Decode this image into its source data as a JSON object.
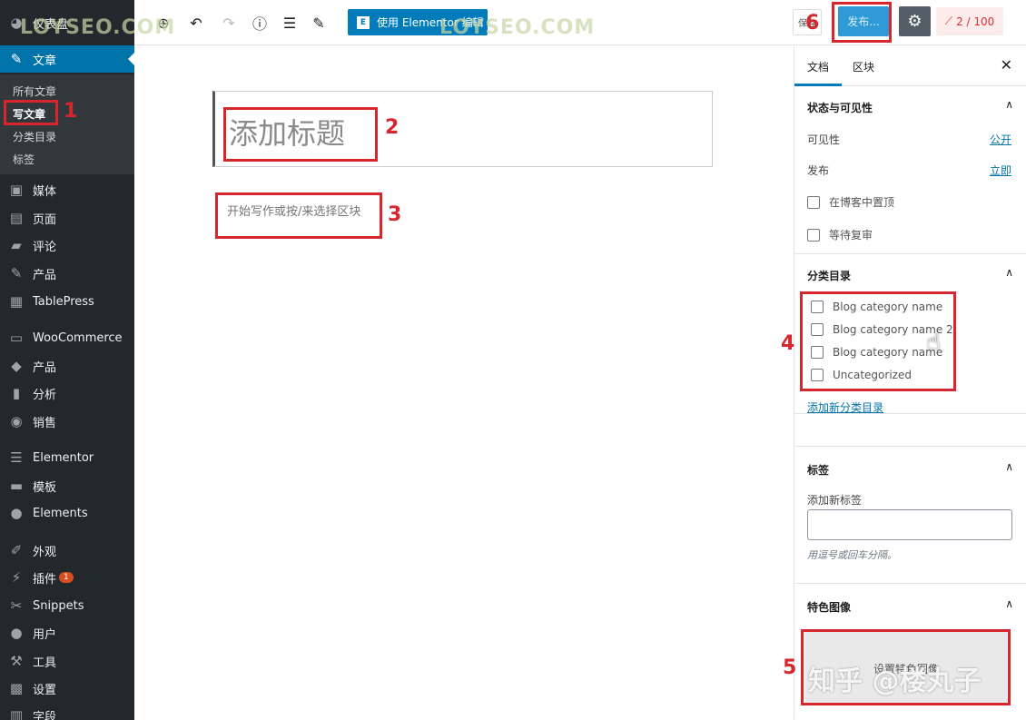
{
  "admin_menu": {
    "items": [
      {
        "label": "仪表盘",
        "icon": "dashboard-icon"
      },
      {
        "label": "文章",
        "icon": "pin-icon"
      },
      {
        "label": "媒体",
        "icon": "media-icon"
      },
      {
        "label": "页面",
        "icon": "pages-icon"
      },
      {
        "label": "评论",
        "icon": "comments-icon"
      },
      {
        "label": "产品",
        "icon": "pin-icon"
      },
      {
        "label": "TablePress",
        "icon": "table-icon"
      },
      {
        "label": "WooCommerce",
        "icon": "woocommerce-icon"
      },
      {
        "label": "产品",
        "icon": "box-icon"
      },
      {
        "label": "分析",
        "icon": "chart-icon"
      },
      {
        "label": "销售",
        "icon": "megaphone-icon"
      },
      {
        "label": "Elementor",
        "icon": "elementor-icon"
      },
      {
        "label": "模板",
        "icon": "folder-icon"
      },
      {
        "label": "Elements",
        "icon": "leaf-icon"
      },
      {
        "label": "外观",
        "icon": "brush-icon"
      },
      {
        "label": "插件",
        "icon": "plugin-icon",
        "badge": "1"
      },
      {
        "label": "Snippets",
        "icon": "scissors-icon"
      },
      {
        "label": "用户",
        "icon": "user-icon"
      },
      {
        "label": "工具",
        "icon": "wrench-icon"
      },
      {
        "label": "设置",
        "icon": "settings-icon"
      },
      {
        "label": "字段",
        "icon": "fields-icon"
      }
    ],
    "posts_submenu": [
      "所有文章",
      "写文章",
      "分类目录",
      "标签"
    ]
  },
  "toolbar": {
    "elementor_label": "使用 Elementor 编辑",
    "save_draft_label": "保存",
    "publish_label": "发布...",
    "seo_score": "2 / 100"
  },
  "editor": {
    "title_placeholder": "添加标题",
    "block_placeholder": "开始写作或按/来选择区块"
  },
  "sidebar": {
    "tabs": [
      "文档",
      "区块"
    ],
    "status_panel": {
      "title": "状态与可见性",
      "visibility_label": "可见性",
      "visibility_value": "公开",
      "publish_label": "发布",
      "publish_value": "立即",
      "sticky_label": "在博客中置顶",
      "pending_label": "等待复审"
    },
    "categories_panel": {
      "title": "分类目录",
      "items": [
        "Blog category name",
        "Blog category name 2",
        "Blog category name",
        "Uncategorized"
      ],
      "add_link": "添加新分类目录"
    },
    "tags_panel": {
      "title": "标签",
      "input_label": "添加新标签",
      "help": "用逗号或回车分隔。"
    },
    "featured_panel": {
      "title": "特色图像",
      "button_label": "设置特色图像"
    }
  },
  "annotations": [
    "1",
    "2",
    "3",
    "4",
    "5",
    "6"
  ],
  "watermarks": {
    "site": "LOYSEO.COM",
    "zhihu": "知乎 @楼丸子"
  },
  "colors": {
    "admin_bg": "#23282d",
    "accent": "#0073aa",
    "annotation": "#d7262e"
  }
}
